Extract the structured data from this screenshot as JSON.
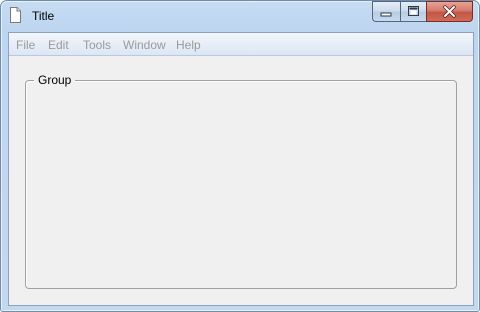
{
  "window": {
    "title": "Title",
    "icon": "document-icon"
  },
  "caption_buttons": {
    "minimize_icon": "minimize-icon",
    "maximize_icon": "maximize-icon",
    "close_icon": "close-icon"
  },
  "menubar": {
    "items": [
      {
        "label": "File",
        "enabled": false
      },
      {
        "label": "Edit",
        "enabled": false
      },
      {
        "label": "Tools",
        "enabled": false
      },
      {
        "label": "Window",
        "enabled": false
      },
      {
        "label": "Help",
        "enabled": false
      }
    ]
  },
  "group": {
    "label": "Group"
  },
  "colors": {
    "close_button": "#c9584a",
    "menu_text_disabled": "#9a9a9a",
    "client_background": "#f0f0f0"
  }
}
